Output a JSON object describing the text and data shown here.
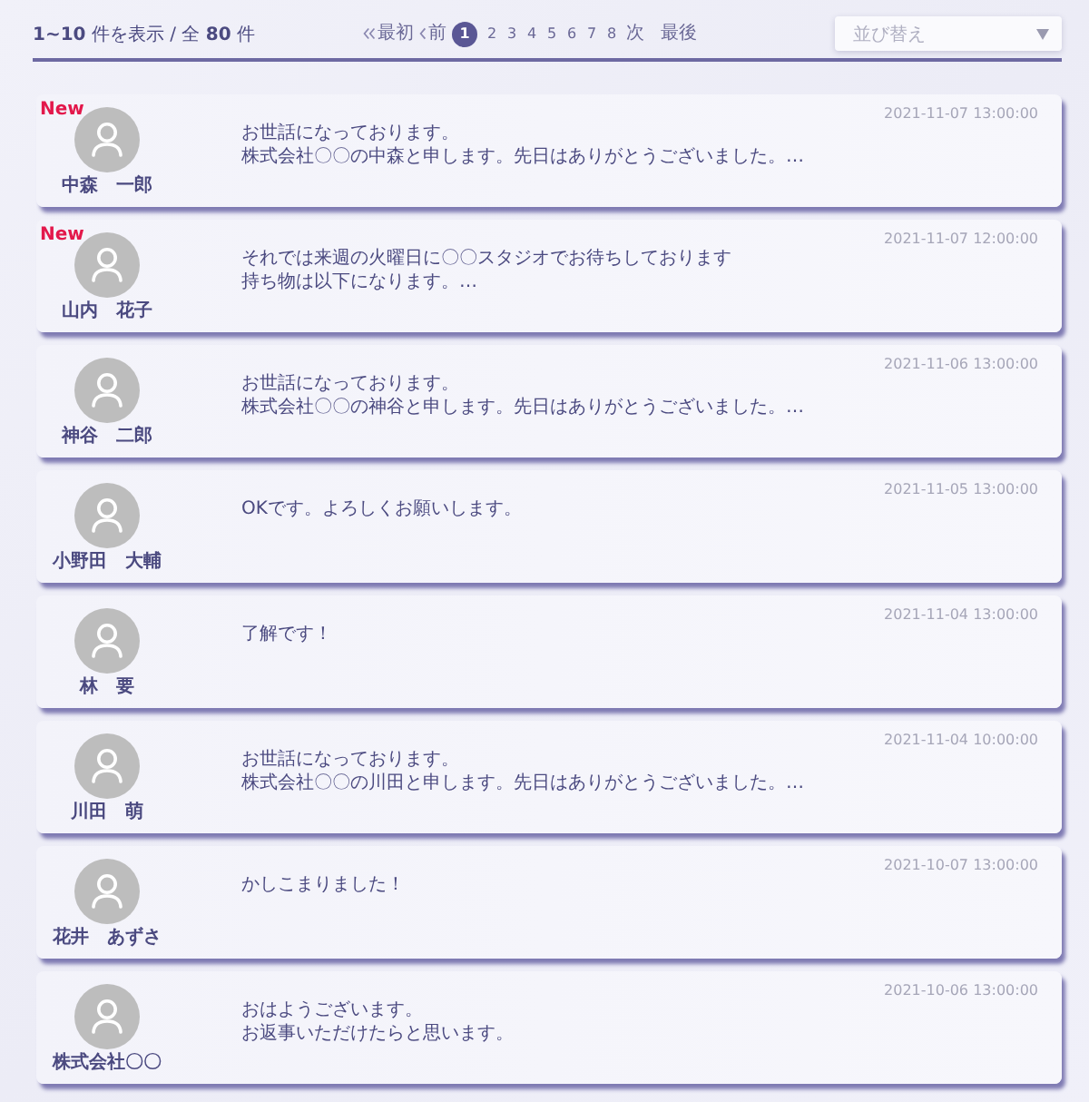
{
  "summary": {
    "text": "**1~10** 件を表示 / 全 **80** 件"
  },
  "pagination": {
    "first": "最初",
    "prev": "前",
    "pages": [
      {
        "label": "1",
        "selected": true
      },
      {
        "label": "2",
        "selected": false
      },
      {
        "label": "3",
        "selected": false
      },
      {
        "label": "4",
        "selected": false
      },
      {
        "label": "5",
        "selected": false
      },
      {
        "label": "6",
        "selected": false
      },
      {
        "label": "7",
        "selected": false
      },
      {
        "label": "8",
        "selected": false
      }
    ],
    "next": "次",
    "last": "最後"
  },
  "sort": {
    "placeholder": "並び替え"
  },
  "messages": [
    {
      "badge": "New",
      "name": "中森　一郎",
      "date": "2021-11-07 13:00:00",
      "lines": [
        "お世話になっております。",
        "株式会社〇〇の中森と申します。先日はありがとうございました。…"
      ]
    },
    {
      "badge": "New",
      "name": "山内　花子",
      "date": "2021-11-07 12:00:00",
      "lines": [
        "それでは来週の火曜日に〇〇スタジオでお待ちしております",
        "持ち物は以下になります。…"
      ]
    },
    {
      "name": "神谷　二郎",
      "date": "2021-11-06 13:00:00",
      "lines": [
        "お世話になっております。",
        "株式会社〇〇の神谷と申します。先日はありがとうございました。…"
      ]
    },
    {
      "name": "小野田　大輔",
      "date": "2021-11-05 13:00:00",
      "lines": [
        "OKです。よろしくお願いします。"
      ]
    },
    {
      "name": "林　要",
      "date": "2021-11-04 13:00:00",
      "lines": [
        "了解です！"
      ]
    },
    {
      "name": "川田　萌",
      "date": "2021-11-04 10:00:00",
      "lines": [
        "お世話になっております。",
        "株式会社〇〇の川田と申します。先日はありがとうございました。…"
      ]
    },
    {
      "name": "花井　あずさ",
      "date": "2021-10-07 13:00:00",
      "lines": [
        "かしこまりました！"
      ]
    },
    {
      "name": "株式会社〇〇",
      "date": "2021-10-06 13:00:00",
      "lines": [
        "おはようございます。",
        "お返事いただけたらと思います。"
      ]
    }
  ]
}
